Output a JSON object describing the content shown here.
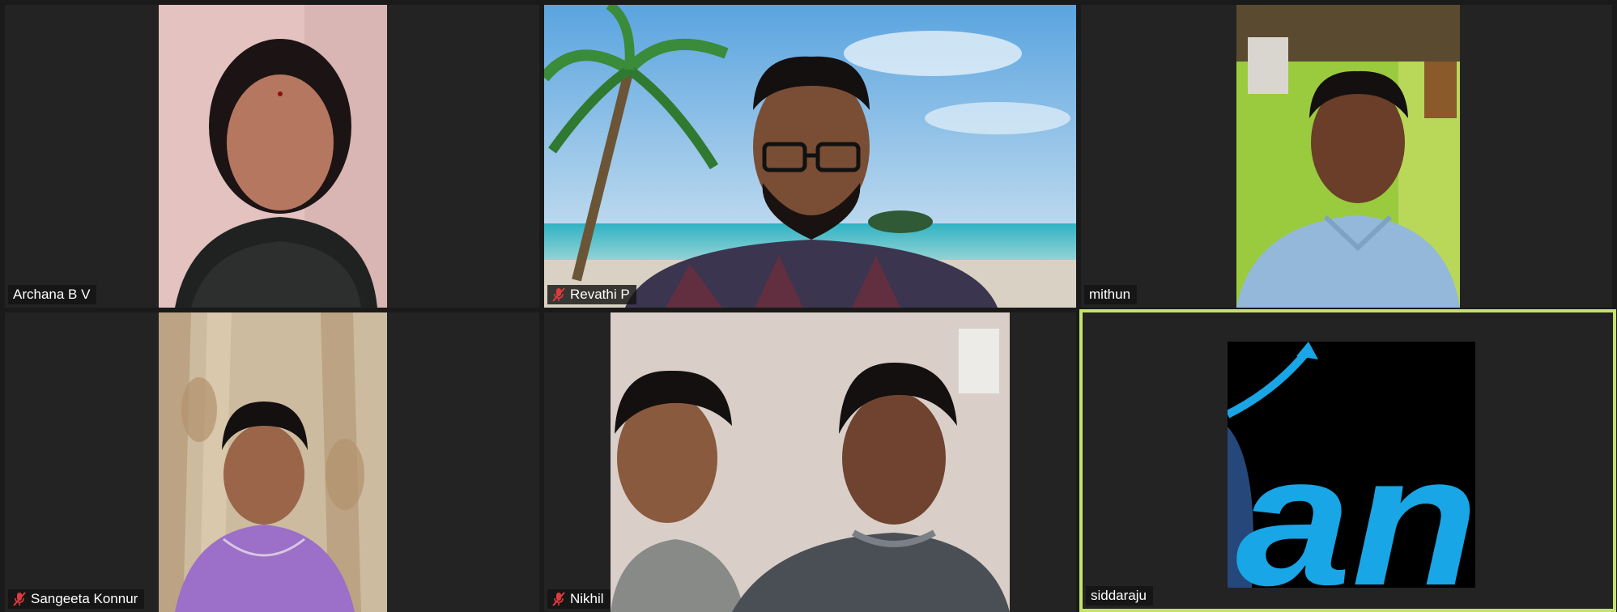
{
  "participants": [
    {
      "name": "Archana B V",
      "muted": false,
      "active": false
    },
    {
      "name": "Revathi P",
      "muted": true,
      "active": false
    },
    {
      "name": "mithun",
      "muted": false,
      "active": false
    },
    {
      "name": "Sangeeta Konnur",
      "muted": true,
      "active": false
    },
    {
      "name": "Nikhil",
      "muted": true,
      "active": false
    },
    {
      "name": "siddaraju",
      "muted": false,
      "active": true,
      "profile_text": "an"
    }
  ],
  "colors": {
    "background": "#1a1a1a",
    "tile": "#232323",
    "active_border": "#c5e26a",
    "muted_icon": "#e0393e",
    "profile_blue": "#19a6e6"
  },
  "icons": {
    "muted": "mic-muted-icon"
  }
}
